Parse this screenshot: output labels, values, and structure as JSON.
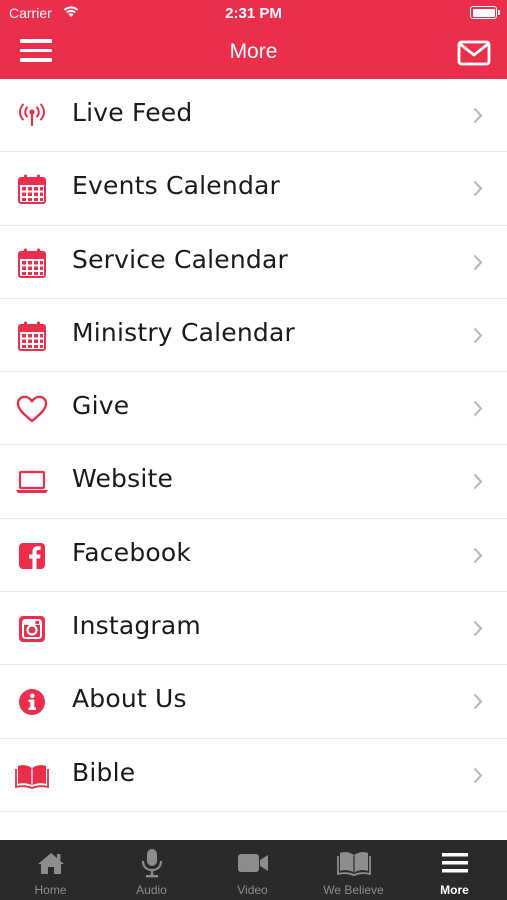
{
  "status_bar": {
    "carrier": "Carrier",
    "time": "2:31 PM"
  },
  "header": {
    "title": "More"
  },
  "menu_items": [
    {
      "label": "Live Feed",
      "icon": "broadcast-icon"
    },
    {
      "label": "Events Calendar",
      "icon": "calendar-icon"
    },
    {
      "label": "Service Calendar",
      "icon": "calendar-icon"
    },
    {
      "label": "Ministry Calendar",
      "icon": "calendar-icon"
    },
    {
      "label": "Give",
      "icon": "heart-icon"
    },
    {
      "label": "Website",
      "icon": "laptop-icon"
    },
    {
      "label": "Facebook",
      "icon": "facebook-icon"
    },
    {
      "label": "Instagram",
      "icon": "instagram-icon"
    },
    {
      "label": "About Us",
      "icon": "info-icon"
    },
    {
      "label": "Bible",
      "icon": "book-icon"
    }
  ],
  "tabs": [
    {
      "label": "Home",
      "icon": "home-icon"
    },
    {
      "label": "Audio",
      "icon": "microphone-icon"
    },
    {
      "label": "Video",
      "icon": "video-camera-icon"
    },
    {
      "label": "We Believe",
      "icon": "book-icon"
    },
    {
      "label": "More",
      "icon": "menu-icon",
      "active": true
    }
  ],
  "colors": {
    "accent": "#ea2e4b",
    "tabbar": "#2a2a2a",
    "inactive_tab": "#8d8d8d",
    "active_tab": "#ffffff"
  }
}
